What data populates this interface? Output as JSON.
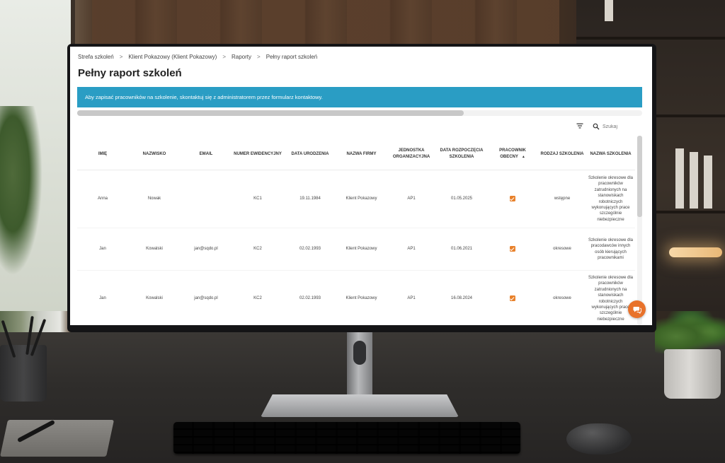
{
  "breadcrumb": {
    "items": [
      "Strefa szkoleń",
      "Klient Pokazowy (Klient Pokazowy)",
      "Raporty",
      "Pełny raport szkoleń"
    ],
    "separator": ">"
  },
  "page": {
    "title": "Pełny raport szkoleń"
  },
  "banner": {
    "text": "Aby zapisać pracowników na szkolenie, skontaktuj się z administratorem przez formularz kontaktowy."
  },
  "toolbar": {
    "search_placeholder": "Szukaj",
    "filter_icon": "filter-icon",
    "search_icon": "search-icon"
  },
  "table": {
    "columns": [
      "Imię",
      "Nazwisko",
      "Email",
      "Numer ewidencyjny",
      "Data urodzenia",
      "Nazwa firmy",
      "Jednostka organizacyjna",
      "Data rozpoczęcia szkolenia",
      "Pracownik obecny",
      "Rodzaj szkolenia",
      "Nazwa szkolenia"
    ],
    "sort_column": "Pracownik obecny",
    "sort_direction": "asc",
    "rows": [
      {
        "first_name": "Anna",
        "last_name": "Nowak",
        "email": "",
        "employee_no": "KC1",
        "birth_date": "19.11.1984",
        "company": "Klient Pokazowy",
        "unit": "AP1",
        "start_date": "01.05.2025",
        "present": true,
        "training_type": "wstępne",
        "training_name": "Szkolenie okresowe dla pracowników zatrudnionych na stanowiskach robotniczych wykonujących prace szczególnie niebezpieczne"
      },
      {
        "first_name": "Jan",
        "last_name": "Kowalski",
        "email": "jan@sqdo.pl",
        "employee_no": "KC2",
        "birth_date": "02.02.1993",
        "company": "Klient Pokazowy",
        "unit": "AP1",
        "start_date": "01.06.2021",
        "present": true,
        "training_type": "okresowe",
        "training_name": "Szkolenie okresowe dla pracodawców innych osób kierujących pracownikami"
      },
      {
        "first_name": "Jan",
        "last_name": "Kowalski",
        "email": "jan@sqdo.pl",
        "employee_no": "KC2",
        "birth_date": "02.02.1993",
        "company": "Klient Pokazowy",
        "unit": "AP1",
        "start_date": "16.08.2024",
        "present": true,
        "training_type": "okresowe",
        "training_name": "Szkolenie okresowe dla pracowników zatrudnionych na stanowiskach robotniczych wykonujących prace szczególnie niebezpieczne"
      }
    ]
  },
  "chat": {
    "icon": "chat-icon"
  },
  "colors": {
    "accent": "#2a9dc4",
    "checkbox": "#e8812b",
    "fab": "#e8722b"
  }
}
